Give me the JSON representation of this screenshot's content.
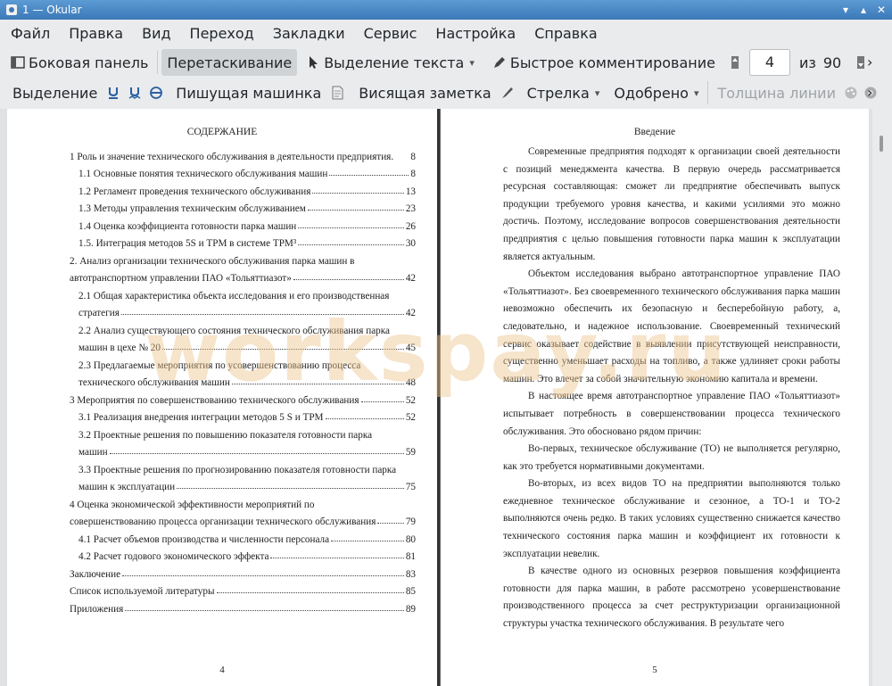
{
  "window": {
    "title": "1  — Okular"
  },
  "menu": [
    "Файл",
    "Правка",
    "Вид",
    "Переход",
    "Закладки",
    "Сервис",
    "Настройка",
    "Справка"
  ],
  "toolbar1": {
    "sidebar_label": "Боковая панель",
    "drag_label": "Перетаскивание",
    "select_text_label": "Выделение текста",
    "quick_comment_label": "Быстрое комментирование",
    "page_current": "4",
    "page_of": "из",
    "page_total": "90"
  },
  "toolbar2": {
    "highlight_label": "Выделение",
    "typewriter_label": "Пишущая машинка",
    "sticky_note_label": "Висящая заметка",
    "arrow_label": "Стрелка",
    "stamp_label": "Одобрено",
    "line_width_label": "Толщина линии"
  },
  "left_page": {
    "title": "СОДЕРЖАНИЕ",
    "page_number": "4",
    "entries": [
      {
        "text": "1 Роль и значение технического обслуживания в деятельности предприятия.",
        "page": "8",
        "level": "top",
        "dots": false
      },
      {
        "text": "1.1 Основные понятия технического обслуживания машин",
        "page": "8",
        "level": "sub",
        "dots": true
      },
      {
        "text": "1.2 Регламент проведения технического обслуживания",
        "page": "13",
        "level": "sub",
        "dots": true
      },
      {
        "text": "1.3 Методы управления техническим обслуживанием",
        "page": "23",
        "level": "sub",
        "dots": true
      },
      {
        "text": "1.4 Оценка коэффициента готовности парка машин",
        "page": "26",
        "level": "sub",
        "dots": true
      },
      {
        "text": "1.5. Интеграция методов 5S и TPM в системе TPM³",
        "page": "30",
        "level": "sub",
        "dots": true
      },
      {
        "text": "2. Анализ организации технического обслуживания парка машин в",
        "page": "",
        "level": "top",
        "dots": false
      },
      {
        "text": "автотранспортном управлении ПАО «Тольяттиазот»",
        "page": "42",
        "level": "top",
        "dots": true
      },
      {
        "text": "2.1 Общая характеристика объекта исследования и его производственная",
        "page": "",
        "level": "sub",
        "dots": false
      },
      {
        "text": "стратегия",
        "page": "42",
        "level": "sub",
        "dots": true
      },
      {
        "text": "2.2 Анализ существующего состояния технического обслуживания парка",
        "page": "",
        "level": "sub",
        "dots": false
      },
      {
        "text": "машин в цехе № 20",
        "page": "45",
        "level": "sub",
        "dots": true
      },
      {
        "text": "2.3 Предлагаемые мероприятия по усовершенствованию процесса",
        "page": "",
        "level": "sub",
        "dots": false
      },
      {
        "text": "технического обслуживания машин",
        "page": "48",
        "level": "sub",
        "dots": true
      },
      {
        "text": "3 Мероприятия по совершенствованию технического обслуживания",
        "page": "52",
        "level": "top",
        "dots": true
      },
      {
        "text": "3.1 Реализация внедрения интеграции методов 5 S и TPM",
        "page": "52",
        "level": "sub",
        "dots": true
      },
      {
        "text": "3.2 Проектные решения по повышению показателя готовности парка",
        "page": "",
        "level": "sub",
        "dots": false
      },
      {
        "text": "машин",
        "page": "59",
        "level": "sub",
        "dots": true
      },
      {
        "text": "3.3 Проектные решения по прогнозированию показателя готовности парка",
        "page": "",
        "level": "sub",
        "dots": false
      },
      {
        "text": "машин к эксплуатации",
        "page": "75",
        "level": "sub",
        "dots": true
      },
      {
        "text": "4 Оценка экономической эффективности мероприятий по",
        "page": "",
        "level": "top",
        "dots": false
      },
      {
        "text": "совершенствованию процесса организации технического обслуживания",
        "page": "79",
        "level": "top",
        "dots": true
      },
      {
        "text": "4.1 Расчет объемов производства и численности персонала",
        "page": "80",
        "level": "sub",
        "dots": true
      },
      {
        "text": "4.2 Расчет годового экономического эффекта",
        "page": "81",
        "level": "sub",
        "dots": true
      },
      {
        "text": "Заключение",
        "page": "83",
        "level": "top",
        "dots": true
      },
      {
        "text": "Список используемой литературы",
        "page": "85",
        "level": "top",
        "dots": true
      },
      {
        "text": "Приложения",
        "page": "89",
        "level": "top",
        "dots": true
      }
    ]
  },
  "right_page": {
    "title": "Введение",
    "page_number": "5",
    "paragraphs": [
      "Современные предприятия подходят к организации своей деятельности с позиций менеджмента качества. В первую очередь рассматривается ресурсная составляющая: сможет ли предприятие обеспечивать выпуск продукции требуемого уровня качества, и какими усилиями это можно достичь. Поэтому, исследование вопросов совершенствования деятельности предприятия с целью повышения готовности парка машин к эксплуатации является актуальным.",
      "Объектом исследования выбрано автотранспортное управление ПАО «Тольяттиазот». Без своевременного технического обслуживания парка машин невозможно обеспечить их безопасную и бесперебойную работу, а, следовательно, и надежное использование. Своевременный технический сервис оказывает содействие в выявлении присутствующей неисправности, существенно уменьшает расходы на топливо, а также удлиняет сроки работы машин. Это влечет за собой значительную экономию капитала и времени.",
      "В настоящее время автотранспортное управление ПАО «Тольяттиазот» испытывает потребность в совершенствовании процесса технического обслуживания. Это обосновано рядом причин:",
      "Во-первых, техническое обслуживание (ТО) не выполняется регулярно, как это требуется нормативными документами.",
      "Во-вторых, из всех видов ТО на предприятии выполняются только ежедневное техническое обслуживание и сезонное, а ТО-1 и ТО-2 выполняются очень редко. В таких условиях существенно снижается качество технического состояния парка машин и коэффициент их готовности к эксплуатации невелик.",
      "В качестве одного из основных резервов повышения коэффициента готовности для парка машин, в работе рассмотрено усовершенствование производственного процесса за счет реструктуризации организационной структуры участка технического обслуживания. В результате чего"
    ]
  },
  "watermark": "workspay.ru",
  "colors": {
    "titlebar": "#3b78b8",
    "active_button": "#d0d3d6",
    "watermark": "#ebc38c"
  }
}
